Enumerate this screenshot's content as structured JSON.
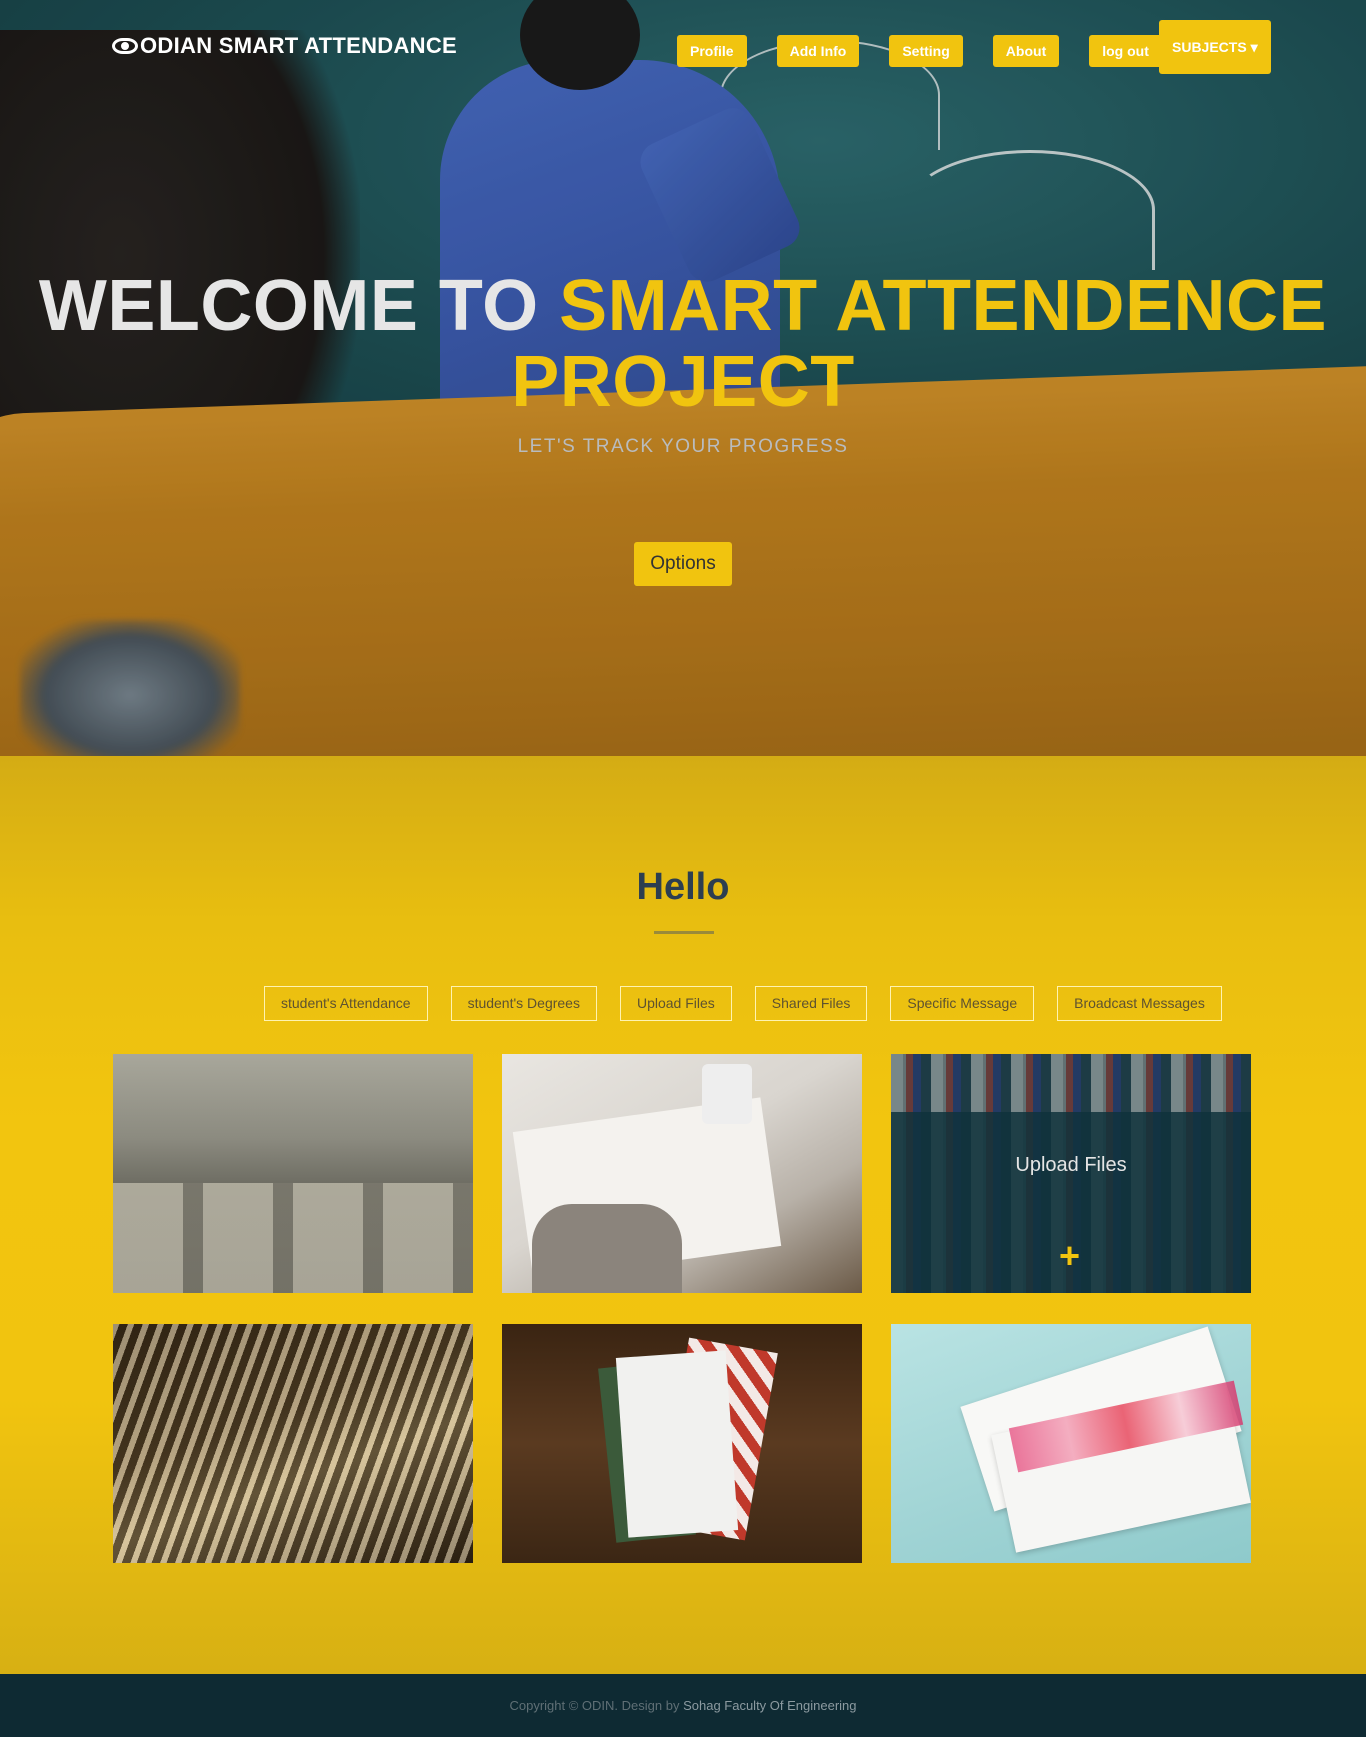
{
  "brand": {
    "name": "ODIAN SMART ATTENDANCE",
    "icon": "eye-icon"
  },
  "nav": {
    "items": [
      "Profile",
      "Add Info",
      "Setting",
      "About",
      "log out"
    ],
    "subjects_label": "SUBJECTS ▾"
  },
  "hero": {
    "title_plain": "WELCOME TO ",
    "title_accent_line1": "SMART ATTENDENCE",
    "title_accent_line2": "PROJECT",
    "subtitle": "LET'S TRACK YOUR PROGRESS",
    "options_label": "Options"
  },
  "section": {
    "heading": "Hello",
    "filters": [
      "student's Attendance",
      "student's Degrees",
      "Upload Files",
      "Shared Files",
      "Specific Message",
      "Broadcast Messages"
    ],
    "tiles": [
      {
        "caption": ""
      },
      {
        "caption": ""
      },
      {
        "caption": "Upload Files",
        "icon": "plus-icon"
      },
      {
        "caption": ""
      },
      {
        "caption": ""
      },
      {
        "caption": ""
      }
    ]
  },
  "footer": {
    "copyright": "Copyright © ODIN. Design by ",
    "credit": "Sohag Faculty Of Engineering"
  },
  "colors": {
    "accent": "#f1c40f",
    "dark": "#0e2a33",
    "heading": "#2c3e50"
  }
}
